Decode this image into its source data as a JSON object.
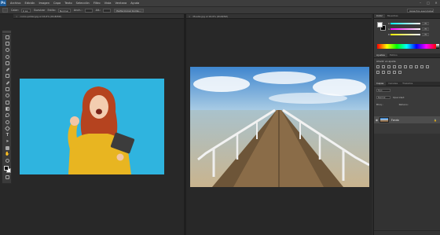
{
  "app": {
    "logo": "Ps",
    "menus": [
      "Archivo",
      "Edición",
      "Imagen",
      "Capa",
      "Texto",
      "Selección",
      "Filtro",
      "Vista",
      "Ventana",
      "Ayuda"
    ],
    "window_controls": [
      "–",
      "□",
      "✕"
    ]
  },
  "options": {
    "tool_icon": "move-tool-icon",
    "blur_label": "Calar:",
    "blur_value": "0 px",
    "antialias_label": "Suavizar",
    "style_label": "Estilo:",
    "style_value": "Normal",
    "width_label": "Anch.:",
    "height_label": "Alt.:",
    "refine_button": "Perfeccionar borde...",
    "workspace_value": "Aspectos esenciales"
  },
  "documents": [
    {
      "tab": "como-pintar.jpg al 16,6% (RGB/8#)",
      "close": "×"
    },
    {
      "tab": "Muelle.jpg al 16,6% (RGB/8#)",
      "close": "×"
    }
  ],
  "panels": {
    "color_tabs": [
      "Color",
      "Muestras"
    ],
    "color": {
      "fg": "#ffffff",
      "bg": "#000000",
      "sliders": [
        {
          "label": "R",
          "value": "255"
        },
        {
          "label": "G",
          "value": "255"
        },
        {
          "label": "B",
          "value": "255"
        }
      ]
    },
    "adjust_tabs": [
      "Ajustes",
      "Estilos"
    ],
    "adjust_title": "Añadir un ajuste",
    "layers_tabs": [
      "Capas",
      "Canales",
      "Trazados"
    ],
    "layers": {
      "kind_label": "Tipo",
      "blend_mode": "Normal",
      "opacity_label": "Opacidad:",
      "lock_label": "Bloq.:",
      "fill_label": "Relleno:",
      "items": [
        {
          "name": "Fondo",
          "visible": true,
          "locked": true
        }
      ]
    }
  },
  "icons": {
    "tools": [
      "move-tool-icon",
      "marquee-tool-icon",
      "lasso-tool-icon",
      "quick-select-tool-icon",
      "crop-tool-icon",
      "eyedropper-tool-icon",
      "healing-brush-tool-icon",
      "brush-tool-icon",
      "clone-stamp-tool-icon",
      "history-brush-tool-icon",
      "eraser-tool-icon",
      "gradient-tool-icon",
      "blur-tool-icon",
      "dodge-tool-icon",
      "pen-tool-icon",
      "type-tool-icon",
      "path-select-tool-icon",
      "rectangle-tool-icon",
      "hand-tool-icon",
      "zoom-tool-icon"
    ]
  }
}
